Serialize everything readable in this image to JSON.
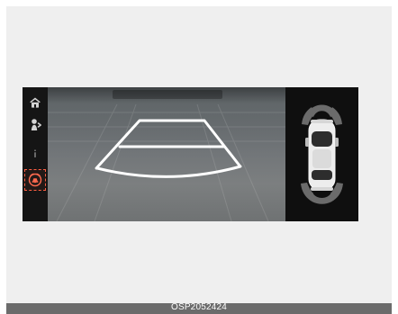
{
  "caption": {
    "code": "OSP2052424"
  },
  "icons": {
    "home": "home-icon",
    "view_toggle": "view-toggle-icon",
    "info": "info-icon",
    "parking_assist": "parking-assist-icon"
  },
  "theme": {
    "caption_bar": "#6b6b6b",
    "highlight": "#ff5f43",
    "guide_lines": "#ffffff",
    "sensor_zones": "#6b6b6b"
  }
}
